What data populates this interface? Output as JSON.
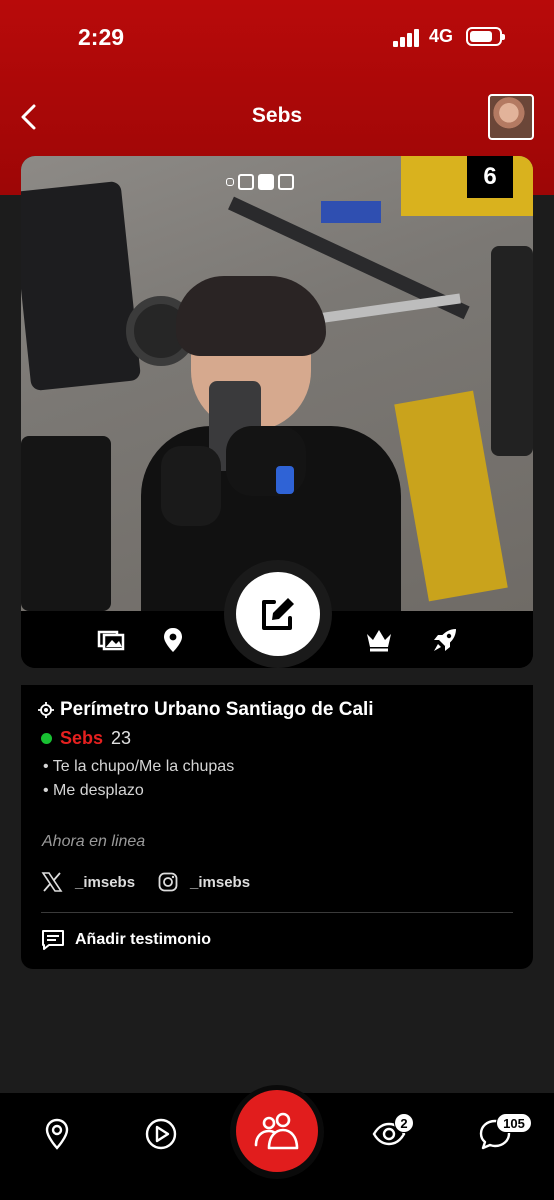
{
  "status_bar": {
    "time": "2:29",
    "network": "4G"
  },
  "nav": {
    "title": "Sebs",
    "back_icon": "chevron-left-icon",
    "avatar_icon": "profile-thumbnail"
  },
  "photo": {
    "count": "6",
    "active_dot": 2,
    "dot_total": 4
  },
  "photo_actions": [
    "gallery-icon",
    "location-pin-icon",
    "edit-icon",
    "crown-icon",
    "rocket-icon"
  ],
  "profile": {
    "location": "Perímetro Urbano Santiago de Cali",
    "username": "Sebs",
    "age": "23",
    "bullets": [
      "• Te la chupo/Me la chupas",
      "• Me desplazo"
    ],
    "activity": "Ahora en linea",
    "x_handle": "_imsebs",
    "instagram_handle": "_imsebs",
    "testimonial_label": "Añadir testimonio"
  },
  "bottom_nav": {
    "items": [
      "map-pin-icon",
      "play-icon",
      "people-icon",
      "eye-icon",
      "chat-icon"
    ],
    "eye_badge": "2",
    "chat_badge": "105"
  },
  "colors": {
    "header_red": "#b80a0a",
    "accent_red": "#e11d1d",
    "online_green": "#18c132",
    "background": "#1c1c1c"
  }
}
